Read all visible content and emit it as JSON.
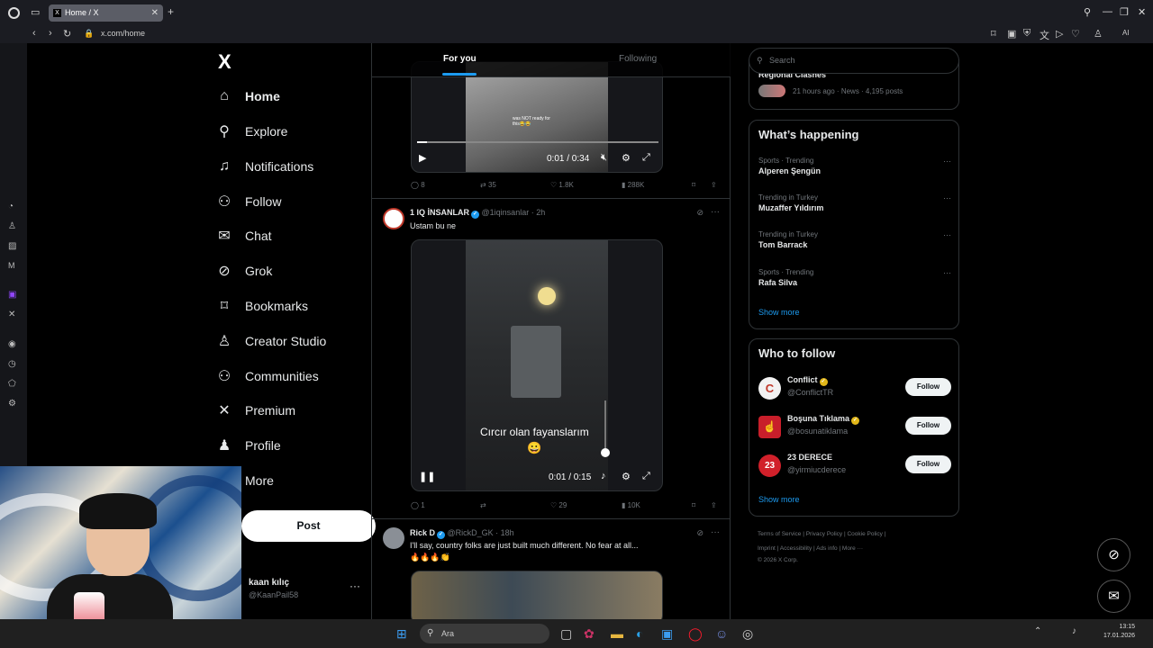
{
  "browser": {
    "tab_title": "Home / X",
    "tab_close": "✕",
    "new_tab": "+",
    "url": "x.com/home",
    "ai_label": "AI"
  },
  "nav": {
    "logo": "X",
    "items": [
      {
        "label": "Home",
        "icon": "home-icon",
        "glyph": "⌂"
      },
      {
        "label": "Explore",
        "icon": "search-icon",
        "glyph": "⚲"
      },
      {
        "label": "Notifications",
        "icon": "bell-icon",
        "glyph": "♫"
      },
      {
        "label": "Follow",
        "icon": "person-add-icon",
        "glyph": "⚇"
      },
      {
        "label": "Chat",
        "icon": "mail-icon",
        "glyph": "✉"
      },
      {
        "label": "Grok",
        "icon": "grok-icon",
        "glyph": "⊘"
      },
      {
        "label": "Bookmarks",
        "icon": "bookmark-icon",
        "glyph": "⌑"
      },
      {
        "label": "Creator Studio",
        "icon": "creator-icon",
        "glyph": "♙"
      },
      {
        "label": "Communities",
        "icon": "communities-icon",
        "glyph": "⚇"
      },
      {
        "label": "Premium",
        "icon": "x-icon",
        "glyph": "✕"
      },
      {
        "label": "Profile",
        "icon": "profile-icon",
        "glyph": "♟"
      },
      {
        "label": "More",
        "icon": "more-icon",
        "glyph": "⋯"
      }
    ],
    "post_label": "Post",
    "account_name": "kaan kılıç",
    "account_handle": "@KaanPail58",
    "account_more": "···"
  },
  "timeline": {
    "tab_for_you": "For you",
    "tab_following": "Following",
    "tweet0": {
      "overlay_text": "was NOT ready for this😂😂",
      "time": "0:01 / 0:34",
      "replies": "8",
      "reposts": "35",
      "likes": "1.8K",
      "views": "288K"
    },
    "tweet1": {
      "name": "1 IQ İNSANLAR",
      "handle": "@1iqinsanlar · 2h",
      "text": "Ustam bu ne",
      "caption": "Cırcır olan fayanslarım",
      "emoji": "😀",
      "time": "0:01 / 0:15",
      "replies": "1",
      "likes": "29",
      "views": "10K",
      "more": "···"
    },
    "tweet2": {
      "name": "Rick D",
      "handle": "@RickD_GK · 18h",
      "text": "I'll say, country folks are just built much different.  No fear at all...",
      "emoji": "🔥🔥🔥👏",
      "more": "···"
    }
  },
  "right": {
    "search_placeholder": "Search",
    "top_news_title": "Regional Clashes",
    "top_news_meta": "21 hours ago · News · 4,195 posts",
    "happening_title": "What’s happening",
    "trends": [
      {
        "cat": "Sports · Trending",
        "name": "Alperen Şengün"
      },
      {
        "cat": "Trending in Turkey",
        "name": "Muzaffer Yıldırım"
      },
      {
        "cat": "Trending in Turkey",
        "name": "Tom Barrack"
      },
      {
        "cat": "Sports · Trending",
        "name": "Rafa Silva"
      }
    ],
    "trend_more": "···",
    "show_more": "Show more",
    "wtf_title": "Who to follow",
    "follows": [
      {
        "name": "Conflict",
        "handle": "@ConflictTR",
        "btn": "Follow",
        "avatar_text": "C"
      },
      {
        "name": "Boşuna Tıklama",
        "handle": "@bosunatiklama",
        "btn": "Follow",
        "avatar_text": "☝"
      },
      {
        "name": "23 DERECE",
        "handle": "@yirmiucderece",
        "btn": "Follow",
        "avatar_text": "23"
      }
    ],
    "wtf_show_more": "Show more",
    "footer_line1": "Terms of Service  |  Privacy Policy  |  Cookie Policy  |",
    "footer_line2": "Imprint  |  Accessibility  |  Ads info  |  More ···",
    "footer_line3": "© 2026 X Corp."
  },
  "taskbar": {
    "search_text": "Ara",
    "time": "13:15",
    "date": "17.01.2026"
  }
}
